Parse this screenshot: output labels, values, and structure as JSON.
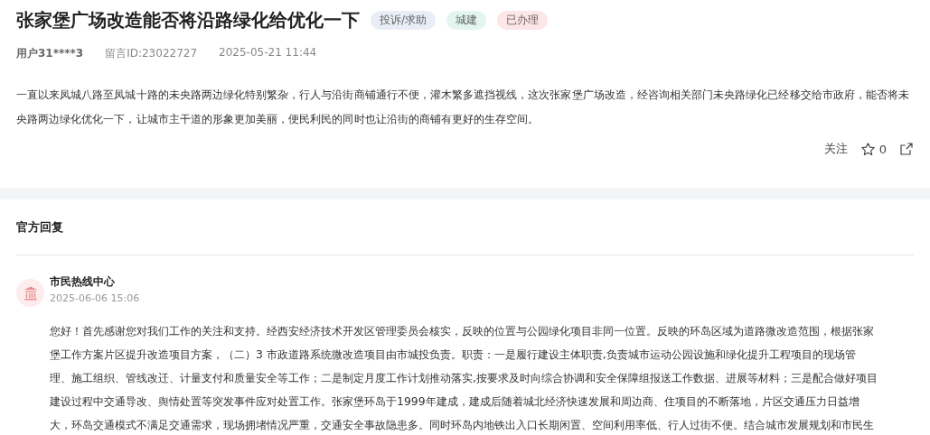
{
  "post": {
    "title": "张家堡广场改造能否将沿路绿化给优化一下",
    "tags": [
      {
        "label": "投诉/求助",
        "color": "#e9eef6"
      },
      {
        "label": "城建",
        "color": "#e3f5ee"
      },
      {
        "label": "已办理",
        "color": "#fde6e7"
      }
    ],
    "user": "用户31****3",
    "message_id": "留言ID:23022727",
    "time": "2025-05-21 11:44",
    "body": "一直以来凤城八路至凤城十路的未央路两边绿化特别繁杂，行人与沿街商铺通行不便，灌木繁多遮挡视线，这次张家堡广场改造，经咨询相关部门未央路绿化已经移交给市政府，能否将未央路两边绿化优化一下，让城市主干道的形象更加美丽，便民利民的同时也让沿街的商铺有更好的生存空间。",
    "follow": "关注",
    "likes": "0"
  },
  "reply": {
    "heading": "官方回复",
    "org": "市民热线中心",
    "time": "2025-06-06 15:06",
    "lines": [
      "您好！首先感谢您对我们工作的关注和支持。经西安经济技术开发区管理委员会核实，反映的位置与公园绿化项目非同一位置。反映的环岛区域为道路微改造范围，根据张家",
      "堡工作方案片区提升改造项目方案，（二）3  市政道路系统微改造项目由市城投负责。职责：一是履行建设主体职责,负责城市运动公园设施和绿化提升工程项目的现场管",
      "理、施工组织、管线改迁、计量支付和质量安全等工作；二是制定月度工作计划推动落实,按要求及时向综合协调和安全保障组报送工作数据、进展等材料；三是配合做好项目",
      "建设过程中交通导改、舆情处置等突发事件应对处置工作。张家堡环岛于1999年建成，建成后随着城北经济快速发展和周边商、住项目的不断落地，片区交通压力日益增",
      "大，环岛交通模式不满足交通需求，现场拥堵情况严重，交通安全事故隐患多。同时环岛内地铁出入口长期闲置、空间利用率低、行人过街不便。结合城市发展规划和市民生"
    ]
  }
}
